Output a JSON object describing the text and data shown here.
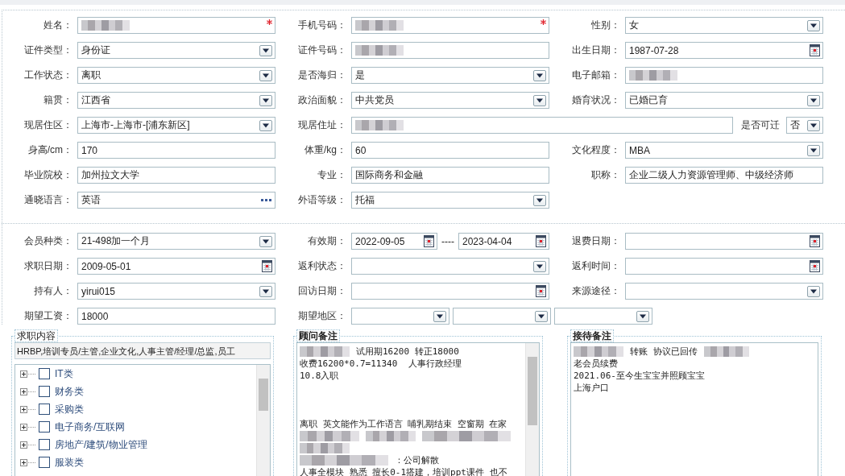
{
  "sections": [
    {
      "rows": [
        [
          {
            "label": "姓名：",
            "kind": "text",
            "redacted": true,
            "required": true
          },
          {
            "label": "手机号码：",
            "kind": "text",
            "redacted": true,
            "required": true
          },
          {
            "label": "性别：",
            "kind": "select",
            "value": "女"
          }
        ],
        [
          {
            "label": "证件类型：",
            "kind": "select",
            "value": "身份证"
          },
          {
            "label": "证件号码：",
            "kind": "text",
            "redacted": true
          },
          {
            "label": "出生日期：",
            "kind": "date",
            "value": "1987-07-28"
          }
        ],
        [
          {
            "label": "工作状态：",
            "kind": "select",
            "value": "离职"
          },
          {
            "label": "是否海归：",
            "kind": "select",
            "value": "是"
          },
          {
            "label": "电子邮箱：",
            "kind": "text",
            "redacted": true
          }
        ],
        [
          {
            "label": "籍贯：",
            "kind": "select",
            "value": "江西省"
          },
          {
            "label": "政治面貌：",
            "kind": "select",
            "value": "中共党员"
          },
          {
            "label": "婚育状况：",
            "kind": "select",
            "value": "已婚已育"
          }
        ],
        [
          {
            "label": "现居住区：",
            "kind": "select",
            "value": "上海市-上海市-[浦东新区]"
          },
          {
            "label": "现居住址：",
            "kind": "text",
            "redacted": true,
            "wide": true,
            "extra": {
              "label": "是否可迁",
              "kind": "select",
              "value": "否"
            }
          }
        ],
        [
          {
            "label": "身高/cm：",
            "kind": "text",
            "value": "170"
          },
          {
            "label": "体重/kg：",
            "kind": "text",
            "value": "60"
          },
          {
            "label": "文化程度：",
            "kind": "select",
            "value": "MBA"
          }
        ],
        [
          {
            "label": "毕业院校：",
            "kind": "text",
            "value": "加州拉文大学"
          },
          {
            "label": "专业：",
            "kind": "text",
            "value": "国际商务和金融"
          },
          {
            "label": "职称：",
            "kind": "text",
            "value": "企业二级人力资源管理师、中级经济师"
          }
        ],
        [
          {
            "label": "通晓语言：",
            "kind": "picker",
            "value": "英语"
          },
          {
            "label": "外语等级：",
            "kind": "select",
            "value": "托福"
          }
        ]
      ]
    },
    {
      "rows": [
        [
          {
            "label": "会员种类：",
            "kind": "select",
            "value": "21-498加一个月"
          },
          {
            "label": "有效期：",
            "kind": "date_range",
            "values": [
              "2022-09-05",
              "2023-04-04"
            ],
            "separator": "----"
          },
          {
            "label": "退费日期：",
            "kind": "date"
          }
        ],
        [
          {
            "label": "求职日期：",
            "kind": "date",
            "value": "2009-05-01"
          },
          {
            "label": "返利状态：",
            "kind": "select"
          },
          {
            "label": "返利时间：",
            "kind": "date"
          }
        ],
        [
          {
            "label": "持有人：",
            "kind": "select",
            "value": "yirui015"
          },
          {
            "label": "回访日期：",
            "kind": "date"
          },
          {
            "label": "来源途径：",
            "kind": "select"
          }
        ],
        [
          {
            "label": "期望工资：",
            "kind": "text",
            "value": "18000"
          },
          {
            "label": "期望地区：",
            "kind": "multi_select",
            "parts": [
              {
                "kind": "select"
              },
              {
                "kind": "select"
              },
              {
                "kind": "select"
              }
            ]
          }
        ]
      ]
    }
  ],
  "panels": [
    {
      "legend": "求职内容",
      "kind": "tree",
      "scrollbar": true,
      "summary": "HRBP,培训专员/主管,企业文化,人事主管/经理/总监,员工",
      "items": [
        {
          "label": "IT类",
          "checked": false,
          "expanded": false
        },
        {
          "label": "财务类",
          "checked": false,
          "expanded": false
        },
        {
          "label": "采购类",
          "checked": false,
          "expanded": false
        },
        {
          "label": "电子商务/互联网",
          "checked": false,
          "expanded": false
        },
        {
          "label": "房地产/建筑/物业管理",
          "checked": false,
          "expanded": false
        },
        {
          "label": "服装类",
          "checked": false,
          "expanded": false
        }
      ]
    },
    {
      "legend": "顾问备注",
      "kind": "notes",
      "scrollbar": true,
      "lines": [
        {
          "kind": "text",
          "segments": [
            {
              "kind": "blurred"
            },
            {
              "kind": "text",
              "text": "试用期16200 转正18000"
            }
          ]
        },
        {
          "kind": "text",
          "segments": [
            {
              "kind": "text",
              "text": "收费16200*0.7=11340  人事行政经理"
            }
          ]
        },
        {
          "kind": "text",
          "segments": [
            {
              "kind": "text",
              "text": "10.8入职"
            }
          ]
        },
        {
          "kind": "blank"
        },
        {
          "kind": "blank"
        },
        {
          "kind": "blank"
        },
        {
          "kind": "text",
          "segments": [
            {
              "kind": "text",
              "text": "离职 英文能作为工作语言 哺乳期结束 空窗期 在家"
            }
          ]
        },
        {
          "kind": "text",
          "segments": [
            {
              "kind": "blurred"
            },
            {
              "kind": "blurred"
            },
            {
              "kind": "blurred"
            }
          ]
        },
        {
          "kind": "text",
          "segments": [
            {
              "kind": "blurred"
            }
          ]
        },
        {
          "kind": "text",
          "segments": [
            {
              "kind": "blurred"
            },
            {
              "kind": "text",
              "text": "：公司解散"
            }
          ]
        },
        {
          "kind": "text",
          "segments": [
            {
              "kind": "text",
              "text": "人事全模块 熟悉 擅长0-1搭建，培训ppt课件 也不"
            }
          ]
        }
      ]
    },
    {
      "legend": "接待备注",
      "kind": "notes",
      "lines": [
        {
          "kind": "text",
          "segments": [
            {
              "kind": "blurred"
            },
            {
              "kind": "text",
              "text": "转账 协议已回传"
            },
            {
              "kind": "blurred"
            }
          ]
        },
        {
          "kind": "text",
          "segments": [
            {
              "kind": "text",
              "text": "老会员续费"
            }
          ]
        },
        {
          "kind": "text",
          "segments": [
            {
              "kind": "text",
              "text": "2021.06-至今生宝宝并照顾宝宝"
            }
          ]
        },
        {
          "kind": "text",
          "segments": [
            {
              "kind": "text",
              "text": "上海户口"
            }
          ]
        }
      ]
    }
  ]
}
